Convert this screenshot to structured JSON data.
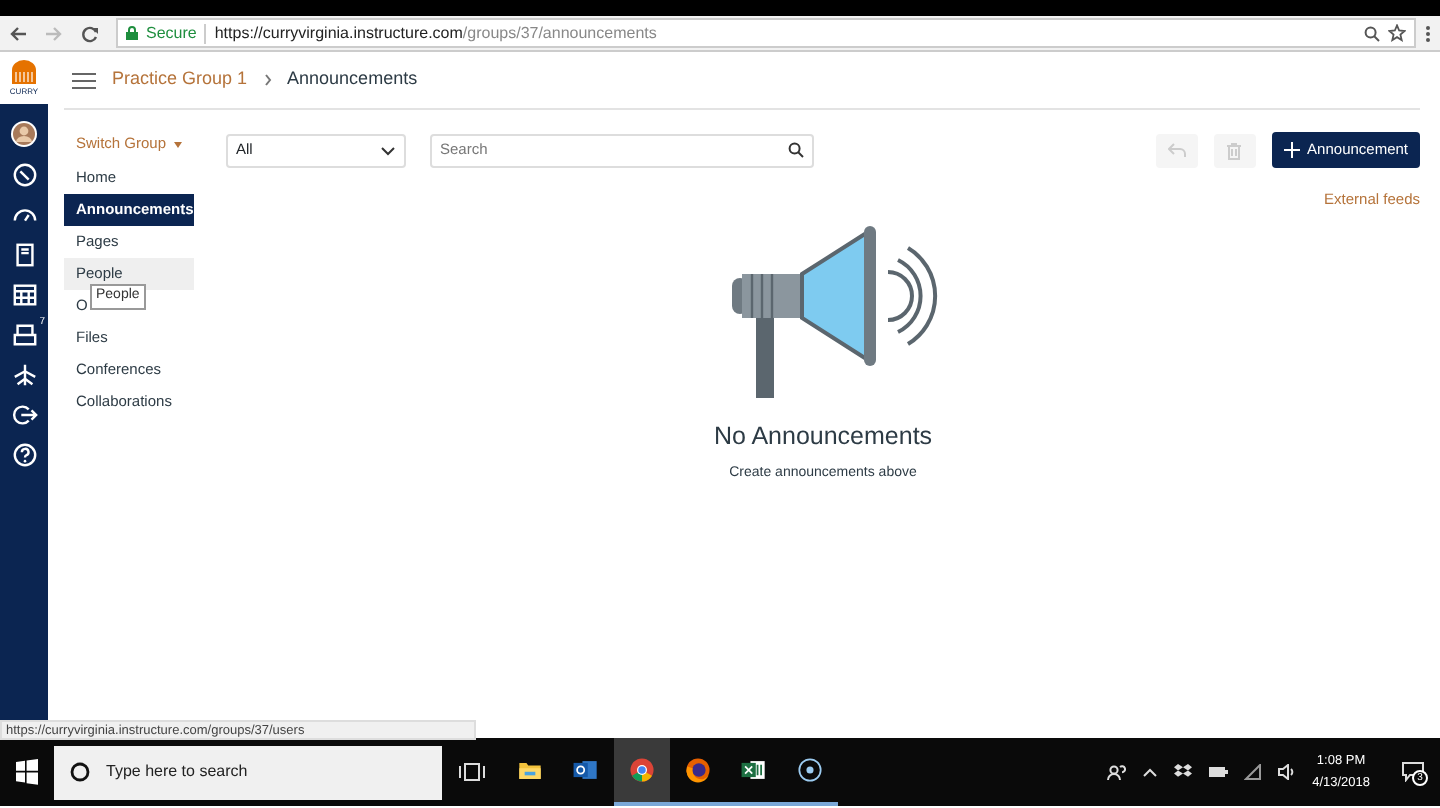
{
  "browser": {
    "secure_label": "Secure",
    "url_host": "https://curryvirginia.instructure.com",
    "url_path": "/groups/37/announcements"
  },
  "global_nav": {
    "logo_text": "CURRY",
    "inbox_badge": "7"
  },
  "header": {
    "breadcrumbs": [
      "Practice Group 1",
      "Announcements"
    ]
  },
  "course_nav": {
    "switch_group": "Switch Group",
    "items": [
      {
        "label": "Home",
        "selected": false,
        "hovered": false
      },
      {
        "label": "Announcements",
        "selected": true,
        "hovered": false
      },
      {
        "label": "Pages",
        "selected": false,
        "hovered": false
      },
      {
        "label": "People",
        "selected": false,
        "hovered": true
      },
      {
        "label": "O",
        "selected": false,
        "hovered": false
      },
      {
        "label": "Files",
        "selected": false,
        "hovered": false
      },
      {
        "label": "Conferences",
        "selected": false,
        "hovered": false
      },
      {
        "label": "Collaborations",
        "selected": false,
        "hovered": false
      }
    ],
    "tooltip": "People"
  },
  "toolbar": {
    "filter": "All",
    "search_placeholder": "Search",
    "reply_disabled": true,
    "delete_disabled": true,
    "add_button": "Announcement"
  },
  "external_feeds": "External feeds",
  "empty_state": {
    "title": "No Announcements",
    "subtitle": "Create announcements above"
  },
  "status_url": "https://curryvirginia.instructure.com/groups/37/users",
  "taskbar": {
    "search_placeholder": "Type here to search",
    "apps": [
      {
        "kind": "explorer",
        "running": false,
        "active": false
      },
      {
        "kind": "outlook",
        "running": false,
        "active": false
      },
      {
        "kind": "chrome",
        "running": true,
        "active": true
      },
      {
        "kind": "firefox",
        "running": true,
        "active": false
      },
      {
        "kind": "excel",
        "running": true,
        "active": false
      },
      {
        "kind": "recorder",
        "running": true,
        "active": false
      }
    ],
    "time": "1:08 PM",
    "date": "4/13/2018",
    "notifications": "3"
  }
}
